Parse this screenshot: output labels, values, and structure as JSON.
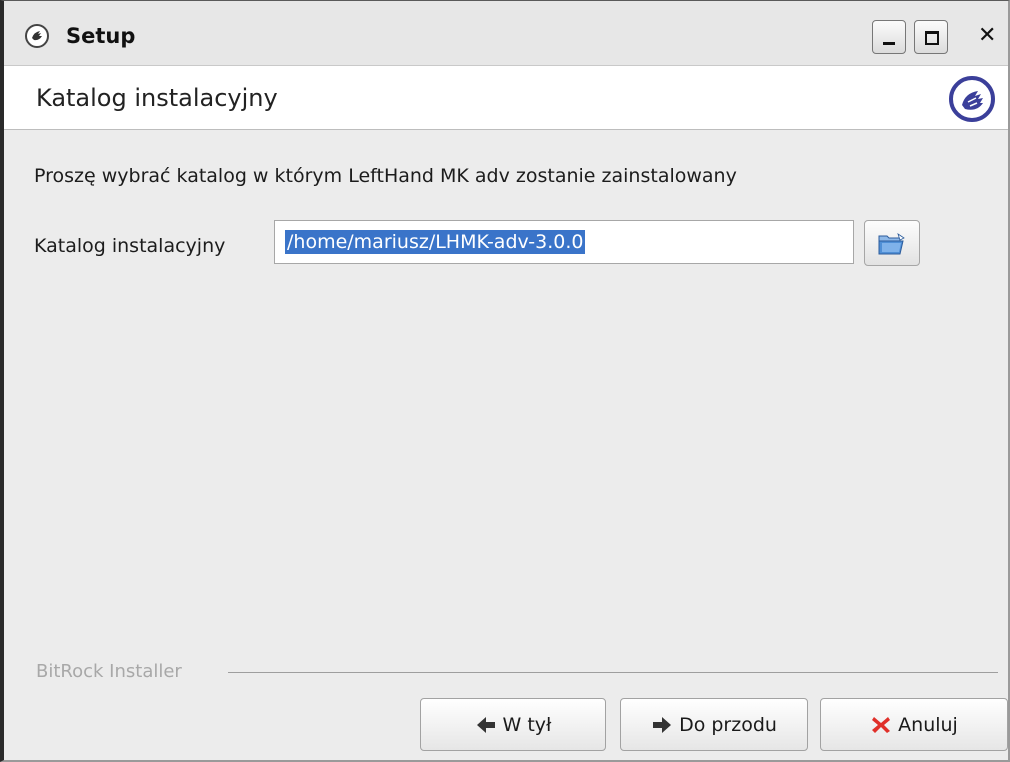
{
  "window": {
    "title": "Setup"
  },
  "header": {
    "title": "Katalog instalacyjny"
  },
  "main": {
    "instruction": "Proszę wybrać katalog w którym  LeftHand MK adv zostanie zainstalowany",
    "field_label": "Katalog instalacyjny",
    "path_value": "/home/mariusz/LHMK-adv-3.0.0"
  },
  "footer": {
    "brand": "BitRock Installer",
    "buttons": {
      "back": "W tył",
      "next": "Do przodu",
      "cancel": "Anuluj"
    }
  },
  "icons": {
    "app": "setup-hand-icon",
    "browse": "folder-open-icon",
    "back": "arrow-left-icon",
    "next": "arrow-right-icon",
    "cancel": "red-x-icon"
  },
  "colors": {
    "selection": "#3a74c9",
    "logo": "#3b3f9a",
    "cancel_icon": "#e0302a"
  }
}
